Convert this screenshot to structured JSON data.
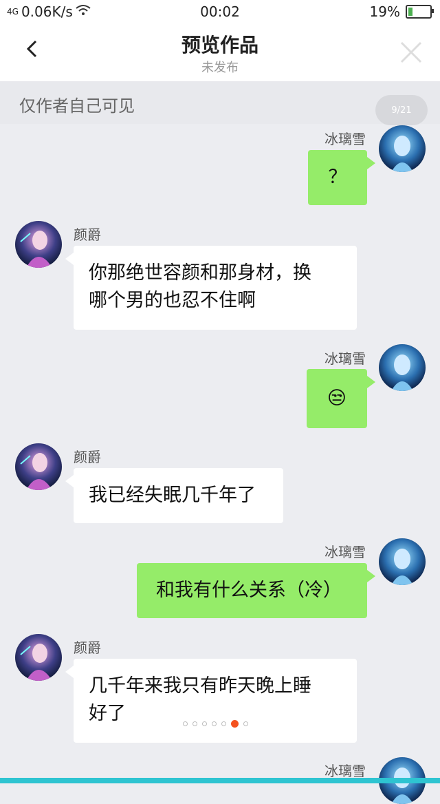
{
  "status": {
    "signal": "4G",
    "speed": "0.06K/s",
    "time": "00:02",
    "battery_pct": "19%"
  },
  "header": {
    "title": "预览作品",
    "subtitle": "未发布"
  },
  "notice": "仅作者自己可见",
  "pager": "9/21",
  "messages": [
    {
      "side": "right",
      "name": "冰璃雪",
      "text": "？"
    },
    {
      "side": "left",
      "name": "颜爵",
      "line1": "你那绝世容颜和那身材，换",
      "line2": "哪个男的也忍不住啊"
    },
    {
      "side": "right",
      "name": "冰璃雪",
      "text": "😒"
    },
    {
      "side": "left",
      "name": "颜爵",
      "text": "我已经失眠几千年了"
    },
    {
      "side": "right",
      "name": "冰璃雪",
      "text": "和我有什么关系（冷）"
    },
    {
      "side": "left",
      "name": "颜爵",
      "line1": "几千年来我只有昨天晚上睡",
      "line2": "好了"
    },
    {
      "side": "right",
      "name": "冰璃雪"
    }
  ],
  "colors": {
    "green_bubble": "#95ec69",
    "accent_bar": "#2ec4d1",
    "active_dot": "#f4511e"
  }
}
